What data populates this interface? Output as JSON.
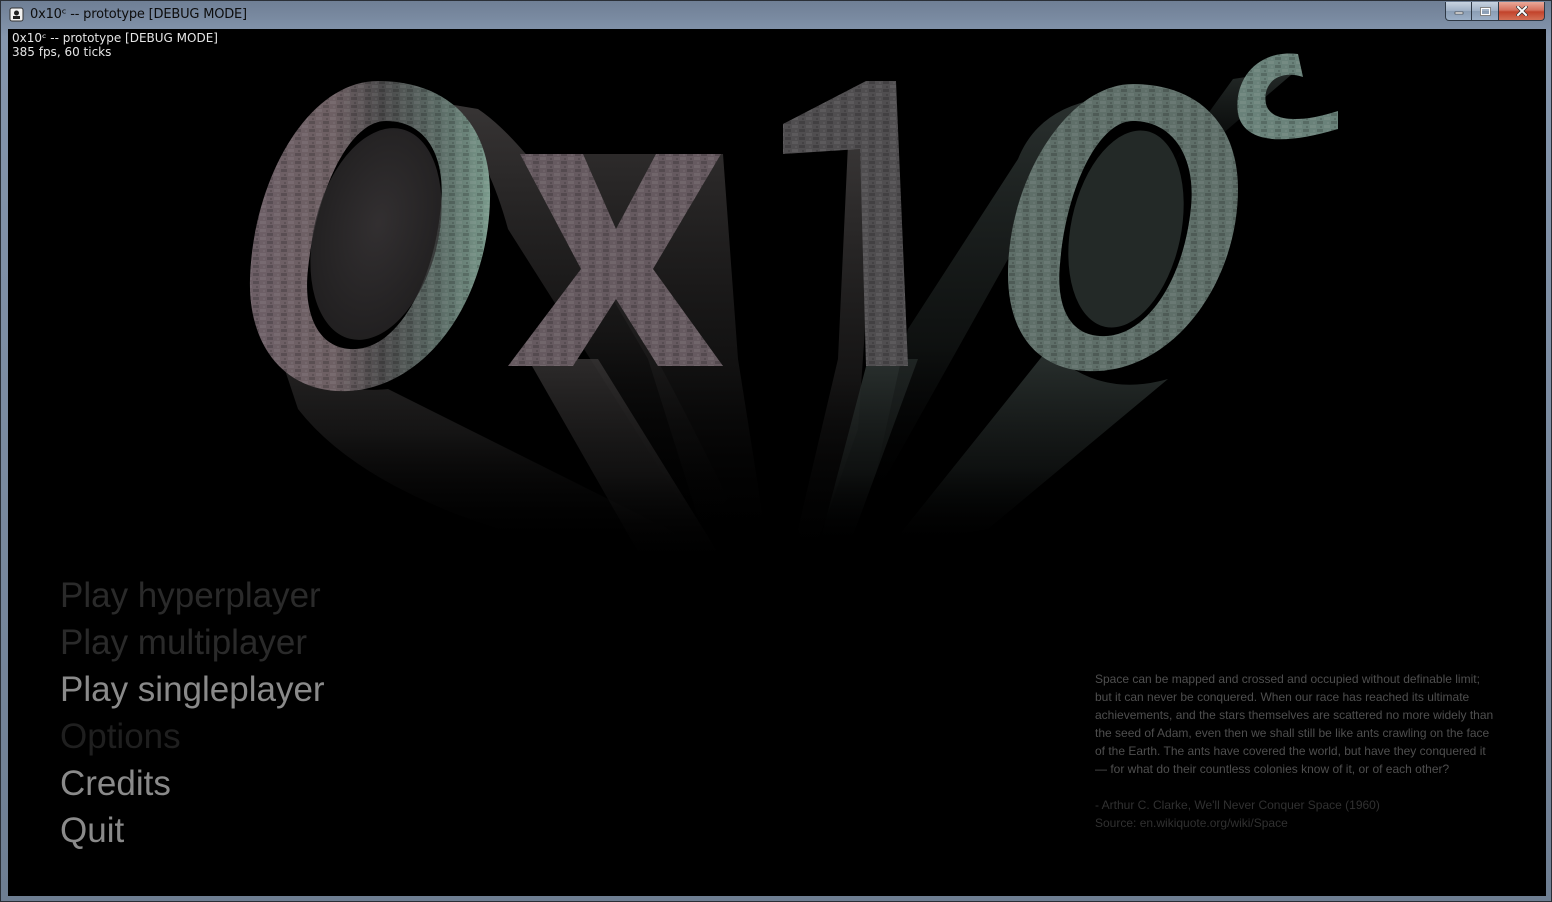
{
  "window": {
    "title": "0x10ᶜ -- prototype [DEBUG MODE]"
  },
  "debug": {
    "line1": "0x10ᶜ -- prototype [DEBUG MODE]",
    "line2": "385 fps, 60 ticks"
  },
  "logo": {
    "text": "0x10",
    "superscript": "c"
  },
  "menu": {
    "items": [
      {
        "label": "Play hyperplayer",
        "state": "dim"
      },
      {
        "label": "Play multiplayer",
        "state": "dim"
      },
      {
        "label": "Play singleplayer",
        "state": "lit"
      },
      {
        "label": "Options",
        "state": "off"
      },
      {
        "label": "Credits",
        "state": "lit"
      },
      {
        "label": "Quit",
        "state": "lit"
      }
    ]
  },
  "quote": {
    "text": "Space can be mapped and crossed and occupied without definable limit; but it can never be conquered. When our race has reached its ultimate achievements, and the stars themselves are scattered no more widely than the seed of Adam, even then we shall still be like ants crawling on the face of the Earth. The ants have covered the world, but have they conquered it — for what do their countless colonies know of it, or of each other?",
    "author": "- Arthur C. Clarke, We'll Never Conquer Space (1960)",
    "source": "Source: en.wikiquote.org/wiki/Space"
  },
  "colors": {
    "background": "#000000",
    "menu_lit": "#8a8a8a",
    "menu_dim": "#2a2a2a",
    "logo_left": "#6d5f66",
    "logo_right": "#6f8a80"
  },
  "icons": {
    "app": "app-icon",
    "minimize": "minimize-icon",
    "maximize": "maximize-icon",
    "close": "close-icon"
  }
}
